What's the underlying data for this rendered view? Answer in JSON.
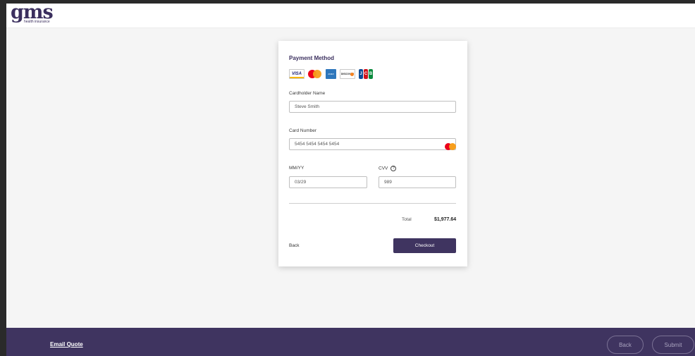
{
  "brand": {
    "name": "gms",
    "tagline": "health insurance"
  },
  "payment": {
    "title": "Payment Method",
    "card_icons": [
      {
        "name": "visa-icon",
        "text": "VISA"
      },
      {
        "name": "mastercard-icon",
        "text": ""
      },
      {
        "name": "amex-icon",
        "text": "AMEX"
      },
      {
        "name": "discover-icon",
        "text": "DISCOVER"
      },
      {
        "name": "jcb-icon",
        "text": "JCB"
      }
    ],
    "cardholder": {
      "label": "Cardholder Name",
      "value": "Steve Smith"
    },
    "card_number": {
      "label": "Card Number",
      "value": "5454 5454 5454 5454",
      "brand_icon": "mastercard-icon"
    },
    "expiry": {
      "label": "MM/YY",
      "value": "03/29"
    },
    "cvv": {
      "label": "CVV",
      "value": "989",
      "help_icon": "?"
    },
    "total_label": "Total",
    "total_value": "$1,977.64",
    "back_label": "Back",
    "checkout_label": "Checkout"
  },
  "footer": {
    "email_quote": "Email Quote",
    "back_label": "Back",
    "submit_label": "Submit"
  },
  "colors": {
    "brand_purple": "#3f3460",
    "logo_purple": "#3b2f5e",
    "page_bg": "#f5f5f5",
    "mastercard_red": "#eb001b",
    "mastercard_orange": "#f79e1b"
  }
}
